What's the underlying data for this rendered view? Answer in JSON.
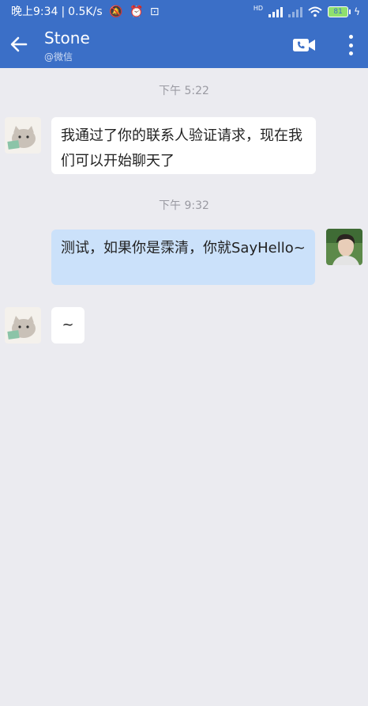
{
  "status_bar": {
    "time": "晚上9:34",
    "speed": "0.5K/s",
    "network": "HD",
    "battery": "81"
  },
  "header": {
    "title": "Stone",
    "subtitle": "@微信"
  },
  "messages": [
    {
      "type": "time",
      "text": "下午 5:22"
    },
    {
      "type": "incoming",
      "text": "我通过了你的联系人验证请求，现在我们可以开始聊天了"
    },
    {
      "type": "time",
      "text": "下午 9:32"
    },
    {
      "type": "outgoing",
      "text": "测试，如果你是霂清，你就SayHello~"
    },
    {
      "type": "incoming",
      "text": "~"
    }
  ],
  "colors": {
    "header_bg": "#3b6fc7",
    "chat_bg": "#ebebf0",
    "outgoing_bubble": "#cbe1fa",
    "incoming_bubble": "#ffffff"
  }
}
